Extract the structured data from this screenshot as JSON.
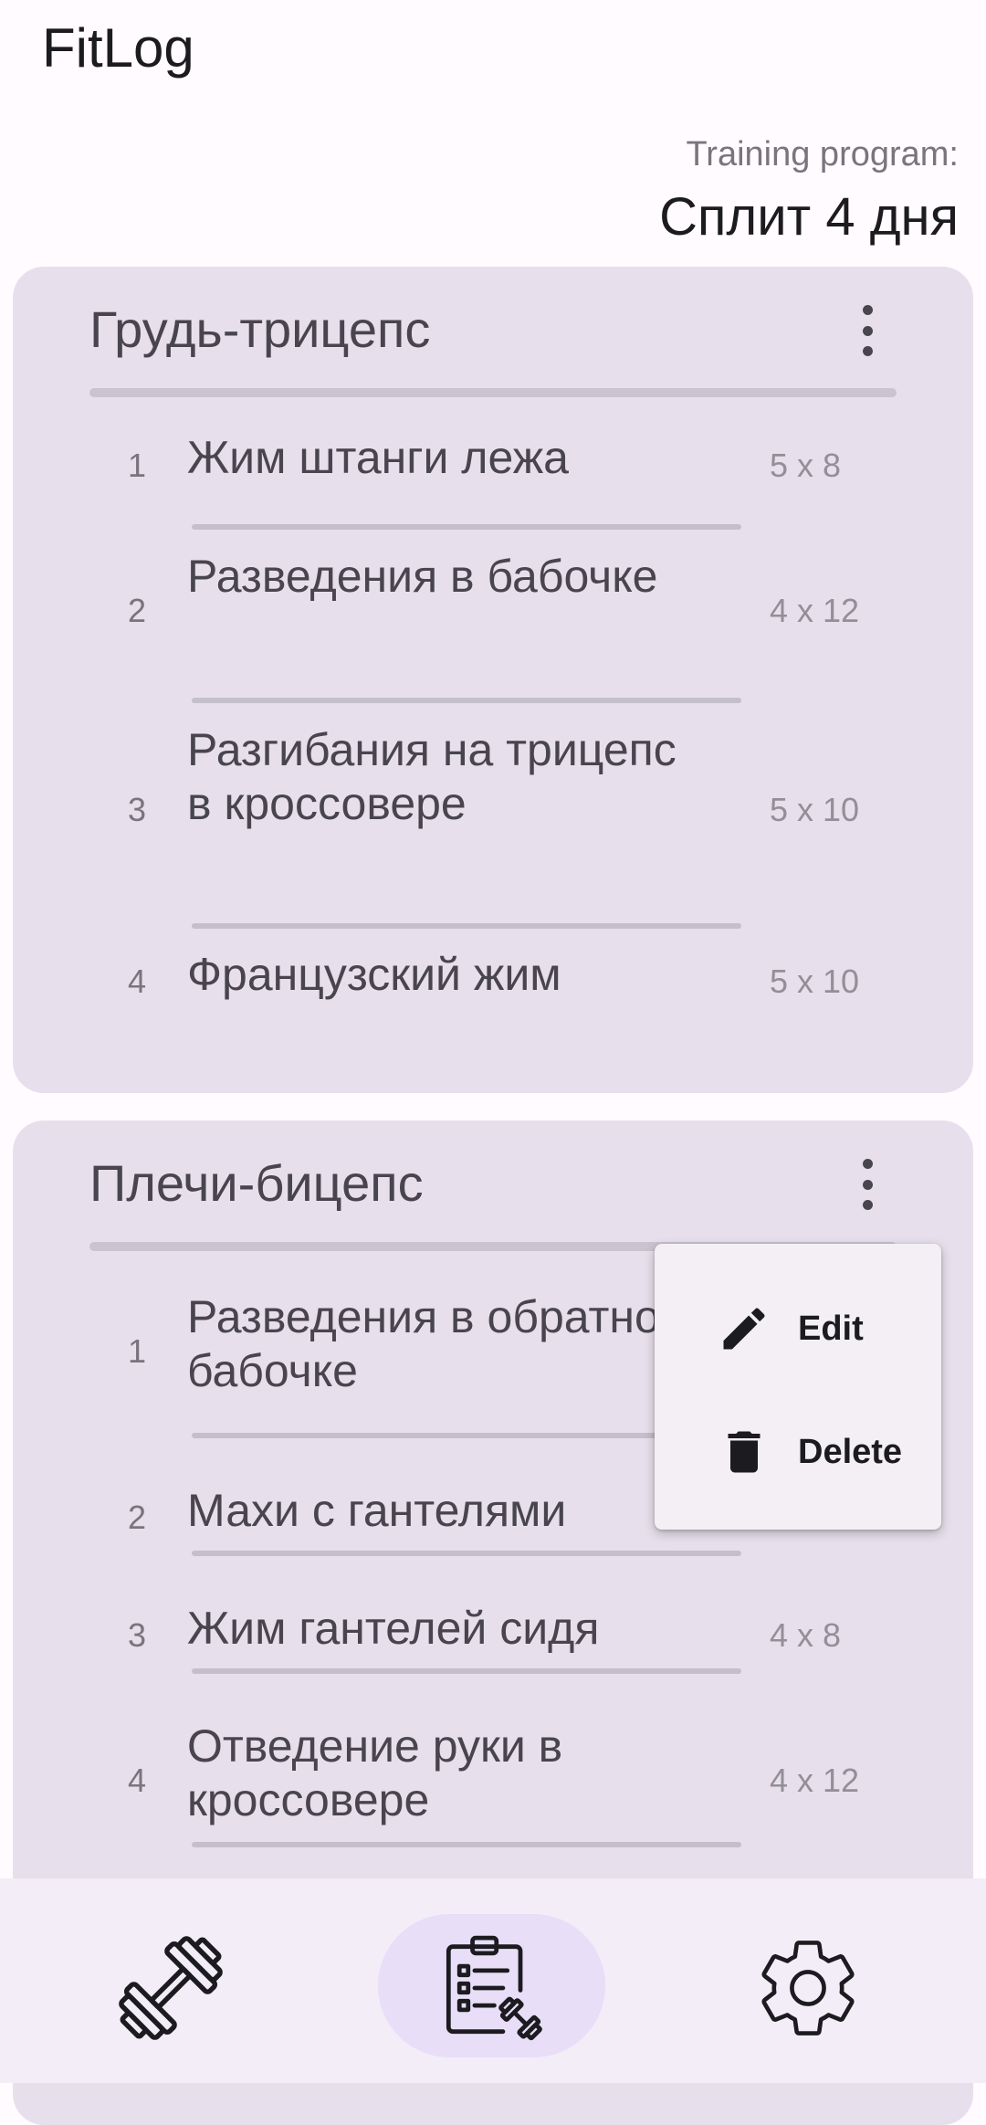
{
  "app": {
    "title": "FitLog"
  },
  "program": {
    "label": "Training program:",
    "name": "Сплит 4 дня"
  },
  "workouts": [
    {
      "title": "Грудь-трицепс",
      "exercises": [
        {
          "num": "1",
          "name": "Жим штанги лежа",
          "sets": "5 x 8"
        },
        {
          "num": "2",
          "name": "Разведения в бабочке",
          "sets": "4 x 12"
        },
        {
          "num": "3",
          "name": "Разгибания на трицепс в кроссовере",
          "sets": "5 x 10"
        },
        {
          "num": "4",
          "name": "Французский жим",
          "sets": "5 x 10"
        }
      ]
    },
    {
      "title": "Плечи-бицепс",
      "exercises": [
        {
          "num": "1",
          "name": "Разведения в обратной бабочке",
          "sets": ""
        },
        {
          "num": "2",
          "name": "Махи с гантелями",
          "sets": ""
        },
        {
          "num": "3",
          "name": "Жим гантелей сидя",
          "sets": "4 x 8"
        },
        {
          "num": "4",
          "name": "Отведение руки в кроссовере",
          "sets": "4 x 12"
        }
      ]
    }
  ],
  "context_menu": {
    "items": [
      {
        "label": "Edit",
        "icon": "pencil-icon"
      },
      {
        "label": "Delete",
        "icon": "trash-icon"
      }
    ]
  },
  "navbar": {
    "items": [
      {
        "icon": "dumbbell-icon",
        "selected": false
      },
      {
        "icon": "clipboard-dumbbell-icon",
        "selected": true
      },
      {
        "icon": "gear-icon",
        "selected": false
      }
    ]
  },
  "colors": {
    "card_bg": "#e7e0ec",
    "menu_bg": "#f3eff5",
    "nav_bg": "#f3edf7",
    "nav_selected_pill": "#e8def8"
  }
}
